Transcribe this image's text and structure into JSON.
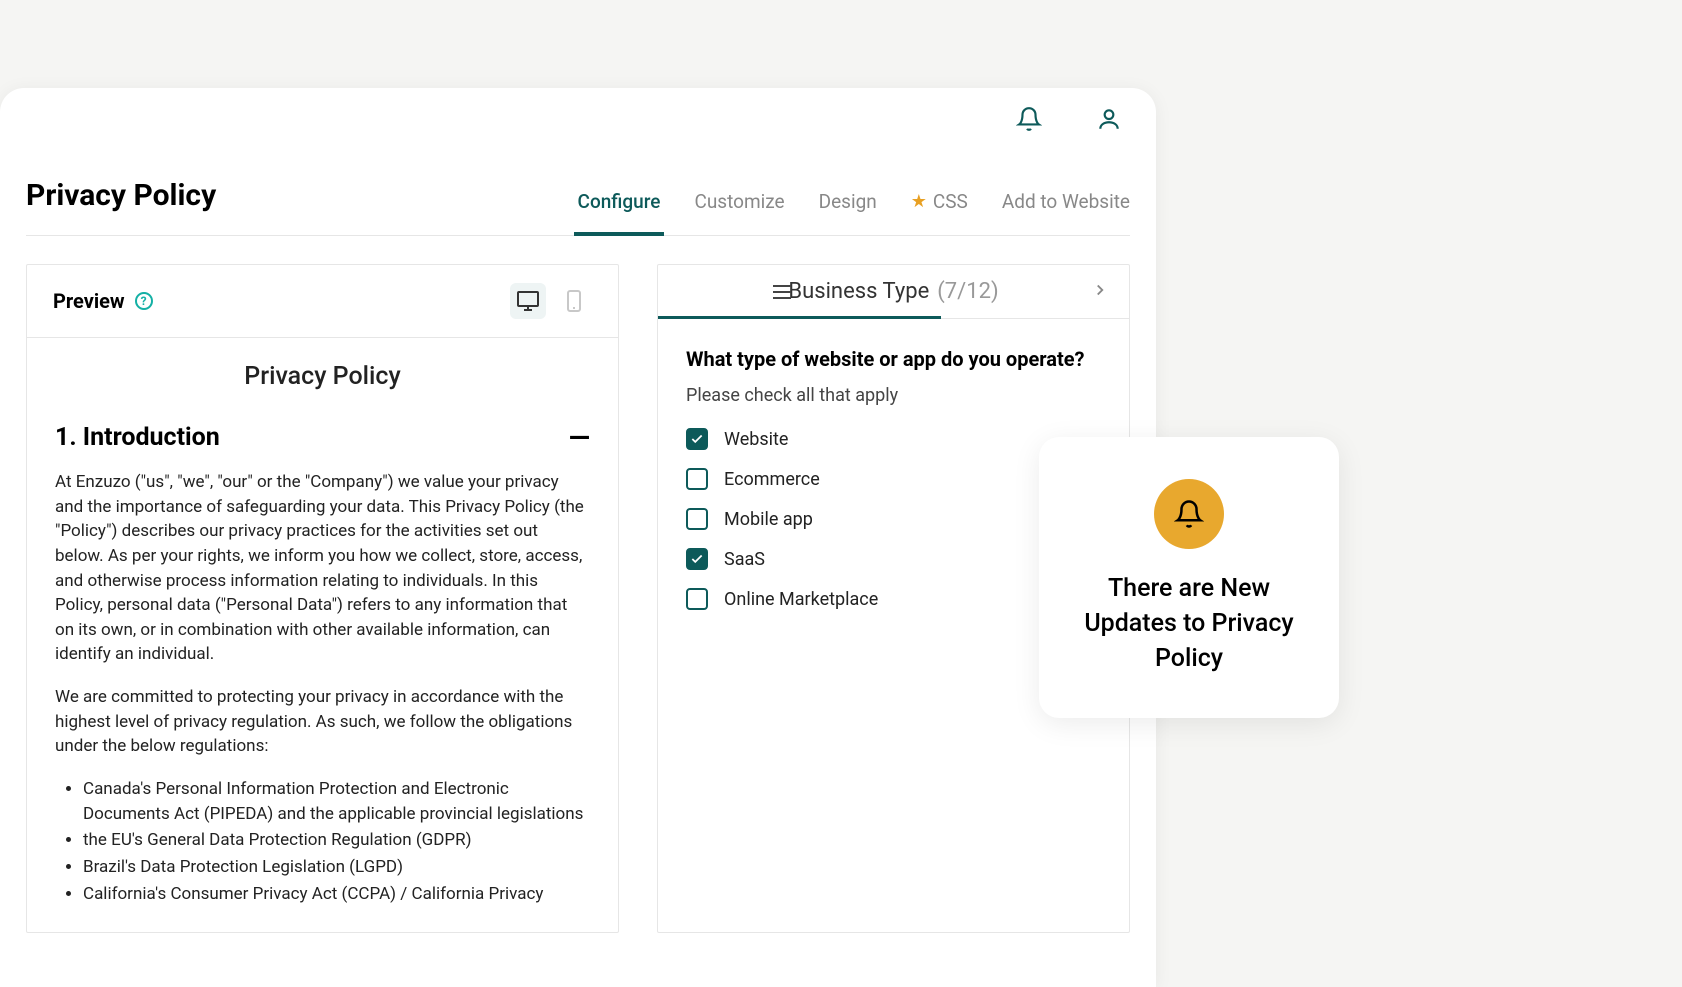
{
  "page_title": "Privacy Policy",
  "tabs": {
    "configure": "Configure",
    "customize": "Customize",
    "design": "Design",
    "css": "CSS",
    "add_to_website": "Add to Website"
  },
  "preview": {
    "label": "Preview",
    "policy_title": "Privacy Policy",
    "section_number_title": "1. Introduction",
    "para1": "At Enzuzo (\"us\", \"we\", \"our\" or the \"Company\") we value your privacy and the importance of safeguarding your data. This Privacy Policy (the \"Policy\") describes our privacy practices for the activities set out below. As per your rights, we inform you how we collect, store, access, and otherwise process information relating to individuals. In this Policy, personal data (\"Personal Data\") refers to any information that on its own, or in combination with other available information, can identify an individual.",
    "para2": "We are committed to protecting your privacy in accordance with the highest level of privacy regulation. As such, we follow the obligations under the below regulations:",
    "bullets": [
      "Canada's Personal Information Protection and Electronic Documents Act (PIPEDA) and the applicable provincial legislations",
      "the EU's General Data Protection Regulation (GDPR)",
      "Brazil's Data Protection Legislation (LGPD)",
      "California's Consumer Privacy Act (CCPA) / California Privacy"
    ]
  },
  "config": {
    "section_title": "Business Type",
    "progress": "(7/12)",
    "question": "What type of website or app do you operate?",
    "subtitle": "Please check all that apply",
    "options": [
      {
        "label": "Website",
        "checked": true
      },
      {
        "label": "Ecommerce",
        "checked": false
      },
      {
        "label": "Mobile app",
        "checked": false
      },
      {
        "label": "SaaS",
        "checked": true
      },
      {
        "label": "Online Marketplace",
        "checked": false
      }
    ]
  },
  "notification": {
    "text": "There are New Updates to Privacy Policy"
  }
}
